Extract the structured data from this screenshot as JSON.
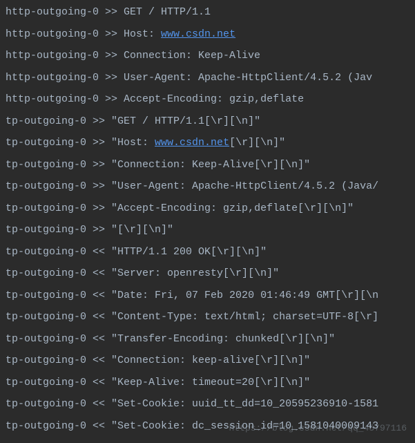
{
  "log": {
    "lines": [
      {
        "prefix": "http-outgoing-0 >> ",
        "text": "GET / HTTP/1.1"
      },
      {
        "prefix": "http-outgoing-0 >> ",
        "text": "Host: ",
        "link": "www.csdn.net"
      },
      {
        "prefix": "http-outgoing-0 >> ",
        "text": "Connection: Keep-Alive"
      },
      {
        "prefix": "http-outgoing-0 >> ",
        "text": "User-Agent: Apache-HttpClient/4.5.2 (Jav"
      },
      {
        "prefix": "http-outgoing-0 >> ",
        "text": "Accept-Encoding: gzip,deflate"
      },
      {
        "prefix": "tp-outgoing-0 >> ",
        "text": "\"GET / HTTP/1.1[\\r][\\n]\""
      },
      {
        "prefix": "tp-outgoing-0 >> ",
        "text": "\"Host: ",
        "link": "www.csdn.net",
        "after": "[\\r][\\n]\""
      },
      {
        "prefix": "tp-outgoing-0 >> ",
        "text": "\"Connection: Keep-Alive[\\r][\\n]\""
      },
      {
        "prefix": "tp-outgoing-0 >> ",
        "text": "\"User-Agent: Apache-HttpClient/4.5.2 (Java/"
      },
      {
        "prefix": "tp-outgoing-0 >> ",
        "text": "\"Accept-Encoding: gzip,deflate[\\r][\\n]\""
      },
      {
        "prefix": "tp-outgoing-0 >> ",
        "text": "\"[\\r][\\n]\""
      },
      {
        "prefix": "tp-outgoing-0 << ",
        "text": "\"HTTP/1.1 200 OK[\\r][\\n]\""
      },
      {
        "prefix": "tp-outgoing-0 << ",
        "text": "\"Server: openresty[\\r][\\n]\""
      },
      {
        "prefix": "tp-outgoing-0 << ",
        "text": "\"Date: Fri, 07 Feb 2020 01:46:49 GMT[\\r][\\n"
      },
      {
        "prefix": "tp-outgoing-0 << ",
        "text": "\"Content-Type: text/html; charset=UTF-8[\\r]"
      },
      {
        "prefix": "tp-outgoing-0 << ",
        "text": "\"Transfer-Encoding: chunked[\\r][\\n]\""
      },
      {
        "prefix": "tp-outgoing-0 << ",
        "text": "\"Connection: keep-alive[\\r][\\n]\""
      },
      {
        "prefix": "tp-outgoing-0 << ",
        "text": "\"Keep-Alive: timeout=20[\\r][\\n]\""
      },
      {
        "prefix": "tp-outgoing-0 << ",
        "text": "\"Set-Cookie: uuid_tt_dd=10_20595236910-1581"
      },
      {
        "prefix": "tp-outgoing-0 << ",
        "text": "\"Set-Cookie: dc_session_id=10_1581040009143"
      }
    ]
  },
  "watermark": "https://blog.csdn.net/qq_45797116"
}
